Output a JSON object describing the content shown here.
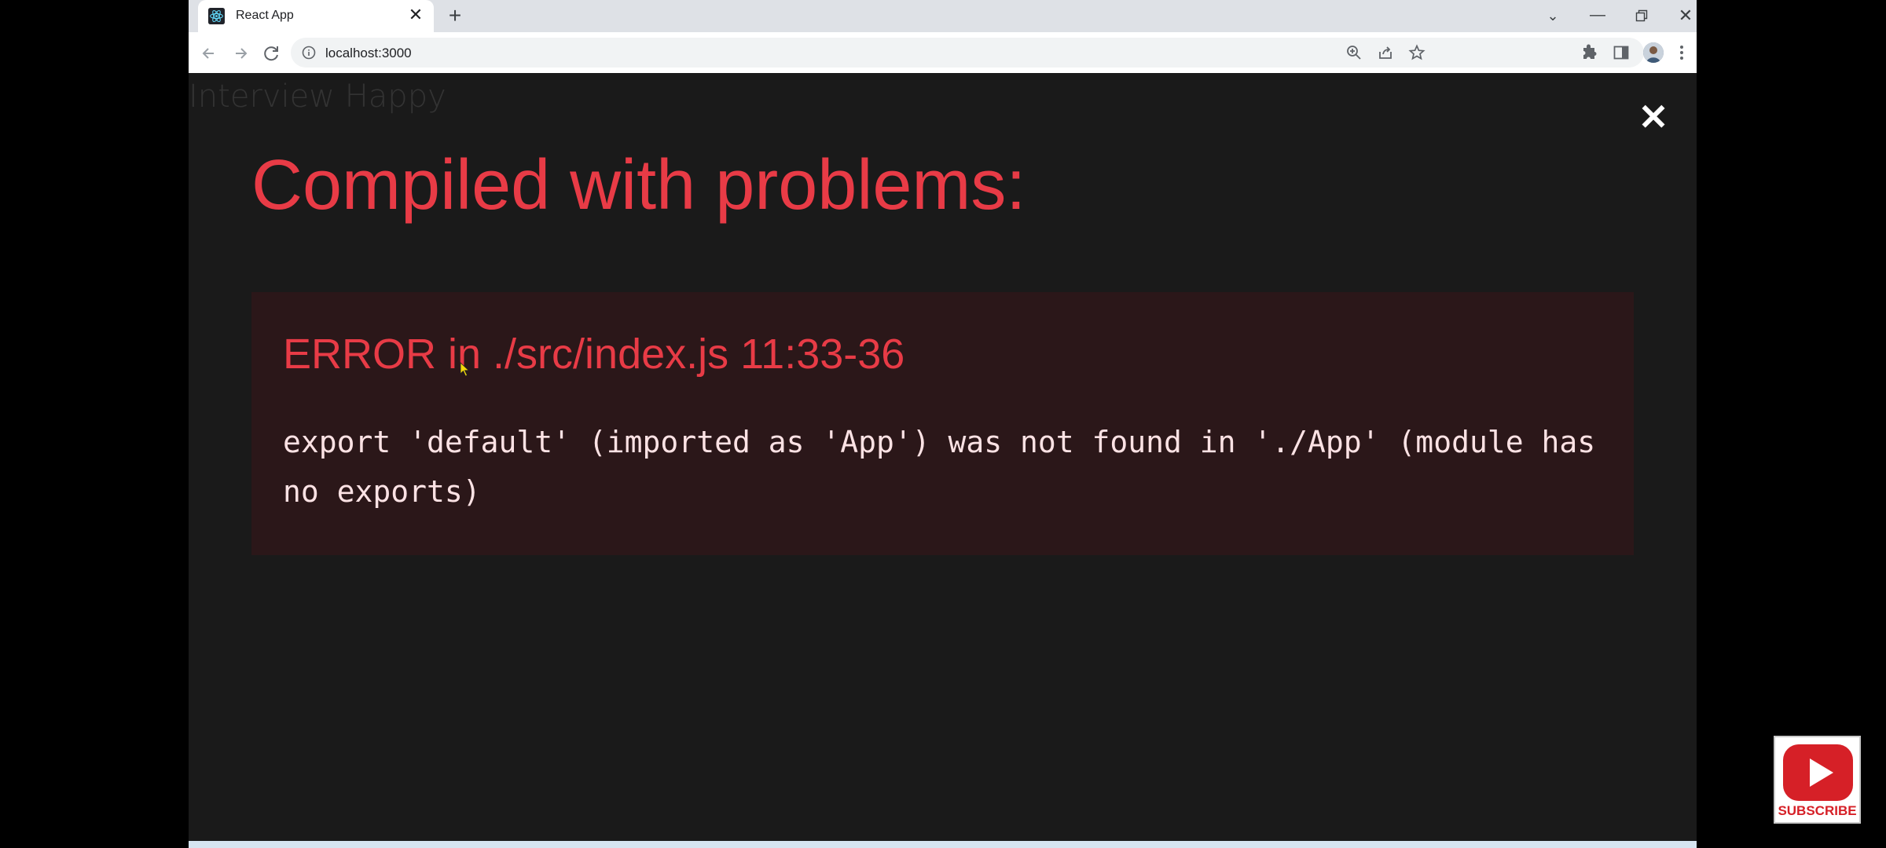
{
  "browser": {
    "tab": {
      "title": "React App",
      "favicon": "react-logo-icon",
      "close_icon": "close-icon"
    },
    "new_tab_icon": "plus-icon",
    "window_controls": [
      "chevron-down-icon",
      "minimize-icon",
      "restore-icon",
      "close-icon"
    ],
    "address_bar": {
      "url": "localhost:3000"
    },
    "toolbar_icons": [
      "back-arrow-icon",
      "forward-arrow-icon",
      "reload-icon",
      "info-icon",
      "zoom-icon",
      "share-icon",
      "bookmark-star-icon",
      "extensions-puzzle-icon",
      "side-panel-icon",
      "profile-avatar",
      "menu-kebab-icon"
    ]
  },
  "page": {
    "app_title": "Interview Happy",
    "overlay": {
      "heading": "Compiled with problems:",
      "close_symbol": "✕",
      "error": {
        "header": "ERROR in ./src/index.js 11:33-36",
        "message": "export 'default' (imported as 'App') was not found in './App' (module has no exports)"
      }
    }
  },
  "subscribe_badge": {
    "label": "SUBSCRIBE"
  },
  "colors": {
    "error_red": "#e83b46",
    "overlay_bg": "#1a1a1a",
    "panel_bg": "#2b1719",
    "message_text": "#fce2e4"
  }
}
